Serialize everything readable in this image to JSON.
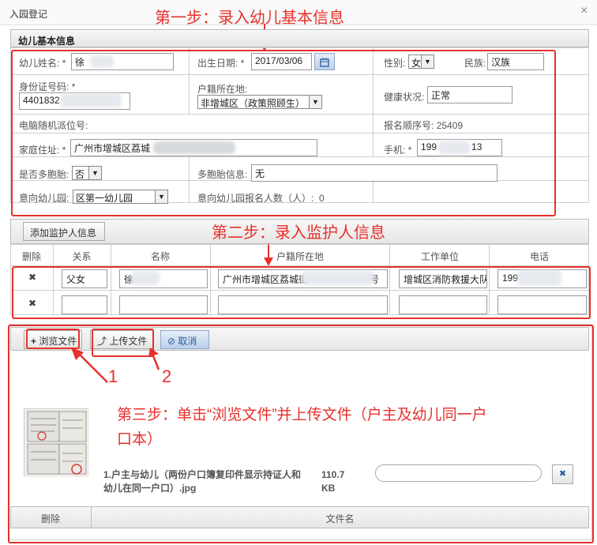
{
  "dialog": {
    "title": "入园登记",
    "close_glyph": "×"
  },
  "annotations": {
    "step1": "第一步：录入幼儿基本信息",
    "step2": "第二步：录入监护人信息",
    "step3_line1": "第三步：单击“浏览文件”并上传文件（户主及幼儿同一户",
    "step3_line2": "口本）",
    "marker1": "1",
    "marker2": "2"
  },
  "child_info": {
    "section_title": "幼儿基本信息",
    "name_label": "幼儿姓名:",
    "name_value": "徐",
    "birth_label": "出生日期:",
    "birth_value": "2017/03/06",
    "gender_label": "性别:",
    "gender_value": "女",
    "ethnicity_label": "民族:",
    "ethnicity_value": "汉族",
    "id_label": "身份证号码:",
    "id_value": "4401832",
    "hukou_label": "户籍所在地:",
    "hukou_value": "非增城区（政策照顾生）",
    "health_label": "健康状况:",
    "health_value": "正常",
    "pc_label": "电脑随机派位号:",
    "order_label": "报名顺序号:",
    "order_value": "25409",
    "address_label": "家庭住址:",
    "address_value": "广州市增城区荔城",
    "phone_label": "手机:",
    "phone_prefix": "199",
    "phone_suffix": "13",
    "multi_label": "是否多胞胎:",
    "multi_value": "否",
    "multi_info_label": "多胞胎信息:",
    "multi_info_value": "无",
    "kg_label": "意向幼儿园:",
    "kg_value": "区第一幼儿园",
    "kg_count_label": "意向幼儿园报名人数（人）:",
    "kg_count_value": "0",
    "required_mark": "*"
  },
  "guardian": {
    "add_button": "添加监护人信息",
    "columns": [
      "删除",
      "关系",
      "名称",
      "户籍所在地",
      "工作单位",
      "电话"
    ],
    "rows": [
      {
        "delete": "✖",
        "relation": "父女",
        "name": "徐",
        "hukou_prefix": "广州市增城区荔城街",
        "hukou_suffix": "号",
        "work": "增城区消防救援大队",
        "phone": "199"
      },
      {
        "delete": "✖",
        "relation": "",
        "name": "",
        "hukou_prefix": "",
        "hukou_suffix": "",
        "work": "",
        "phone": ""
      }
    ]
  },
  "upload": {
    "browse_button": "浏览文件",
    "upload_button": "上传文件",
    "cancel_button": "取消",
    "file_name_line1": "1.户主与幼儿（两份户口簿复印件显示持证人和",
    "file_name_line2": "幼儿在同一户口）.jpg",
    "file_size_line1": "110.7",
    "file_size_line2": "KB",
    "progress": 0,
    "remove_glyph": "✖",
    "table_headers": [
      "删除",
      "文件名"
    ]
  },
  "colors": {
    "accent_red": "#e8302c",
    "button_blue": "#2a5e9c"
  }
}
